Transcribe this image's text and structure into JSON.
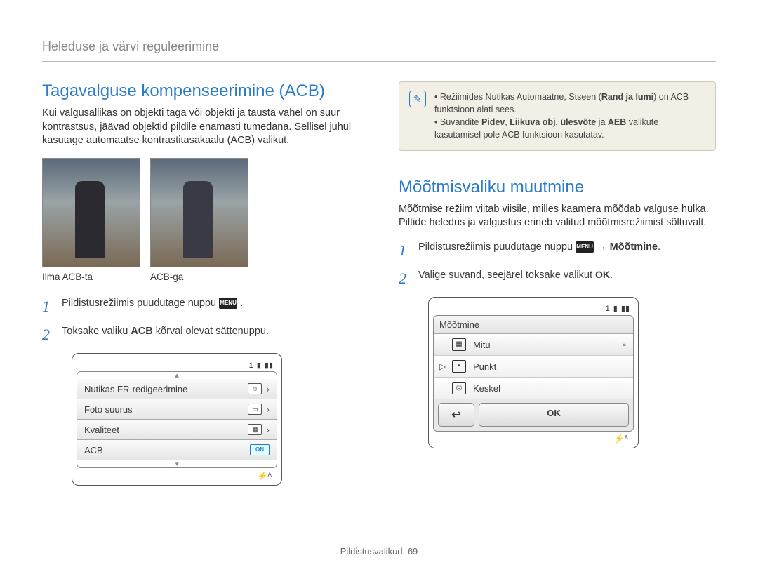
{
  "header": "Heleduse ja värvi reguleerimine",
  "left": {
    "title": "Tagavalguse kompenseerimine (ACB)",
    "intro": "Kui valgusallikas on objekti taga või objekti ja tausta vahel on suur kontrastsus, jäävad objektid pildile enamasti tumedana. Sellisel juhul kasutage automaatse kontrastitasakaalu (ACB) valikut.",
    "caption_without": "Ilma ACB-ta",
    "caption_with": "ACB-ga",
    "step1_pre": "Pildistusrežiimis puudutage nuppu ",
    "step1_post": " .",
    "step2_a": "Toksake valiku ",
    "step2_b": "ACB",
    "step2_c": " kõrval olevat sättenuppu.",
    "ui": {
      "counter": "1",
      "rows": [
        {
          "label": "Nutikas FR-redigeerimine"
        },
        {
          "label": "Foto suurus"
        },
        {
          "label": "Kvaliteet"
        },
        {
          "label": "ACB"
        }
      ],
      "on": "ON"
    }
  },
  "right": {
    "note1_a": "Režiimides Nutikas Automaatne, Stseen (",
    "note1_b": "Rand ja lumi",
    "note1_c": ") on ACB funktsioon alati sees.",
    "note2_a": "Suvandite ",
    "note2_b": "Pidev",
    "note2_c": ", ",
    "note2_d": "Liikuva obj. ülesvõte",
    "note2_e": " ja ",
    "note2_f": "AEB",
    "note2_g": " valikute kasutamisel pole ACB funktsioon kasutatav.",
    "title": "Mõõtmisvaliku muutmine",
    "intro": "Mõõtmise režiim viitab viisile, milles kaamera mõõdab valguse hulka. Piltide heledus ja valgustus erineb valitud mõõtmisrežiimist sõltuvalt.",
    "step1_pre": "Pildistusrežiimis puudutage nuppu ",
    "step1_arrow": " → ",
    "step1_target": "Mõõtmine",
    "step1_post": ".",
    "step2_pre": "Valige suvand, seejärel toksake valikut ",
    "step2_post": ".",
    "ui": {
      "counter": "1",
      "header": "Mõõtmine",
      "items": [
        {
          "label": "Mitu"
        },
        {
          "label": "Punkt"
        },
        {
          "label": "Keskel"
        }
      ],
      "ok": "OK"
    }
  },
  "footer_label": "Pildistusvalikud",
  "footer_page": "69",
  "menu_label": "MENU",
  "ok_label": "OK"
}
